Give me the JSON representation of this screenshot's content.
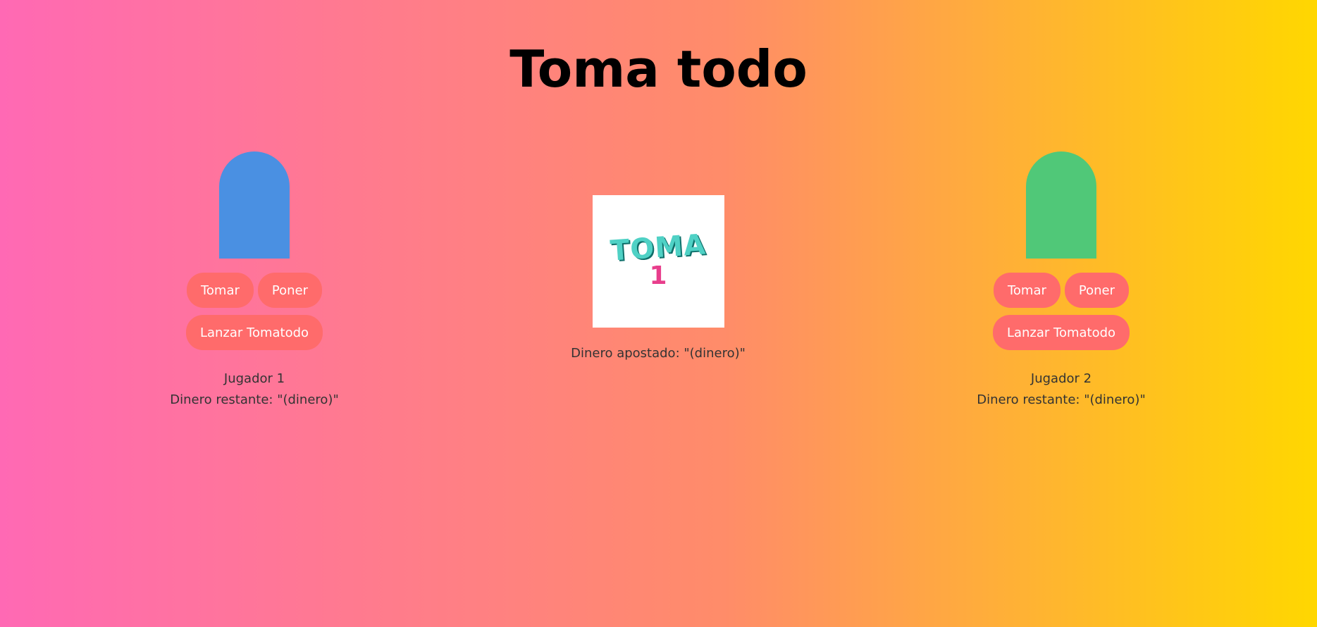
{
  "title": "Toma todo",
  "colors": {
    "gradient_start": "#ff69b4",
    "gradient_mid": "#ff8c69",
    "gradient_end": "#ffd700",
    "button": "#ff6b6b",
    "player1": "#4a90e2",
    "player2": "#50c878",
    "logo_word": "#4fd1c5",
    "logo_number": "#e83e8c"
  },
  "players": [
    {
      "name": "Jugador 1",
      "money": "Dinero restante: \"(dinero)\"",
      "buttons": {
        "take": "Tomar",
        "put": "Poner",
        "launch": "Lanzar Tomatodo"
      }
    },
    {
      "name": "Jugador 2",
      "money": "Dinero restante: \"(dinero)\"",
      "buttons": {
        "take": "Tomar",
        "put": "Poner",
        "launch": "Lanzar Tomatodo"
      }
    }
  ],
  "center": {
    "logo_word": "TOMA",
    "logo_number": "1",
    "bet": "Dinero apostado: \"(dinero)\""
  }
}
